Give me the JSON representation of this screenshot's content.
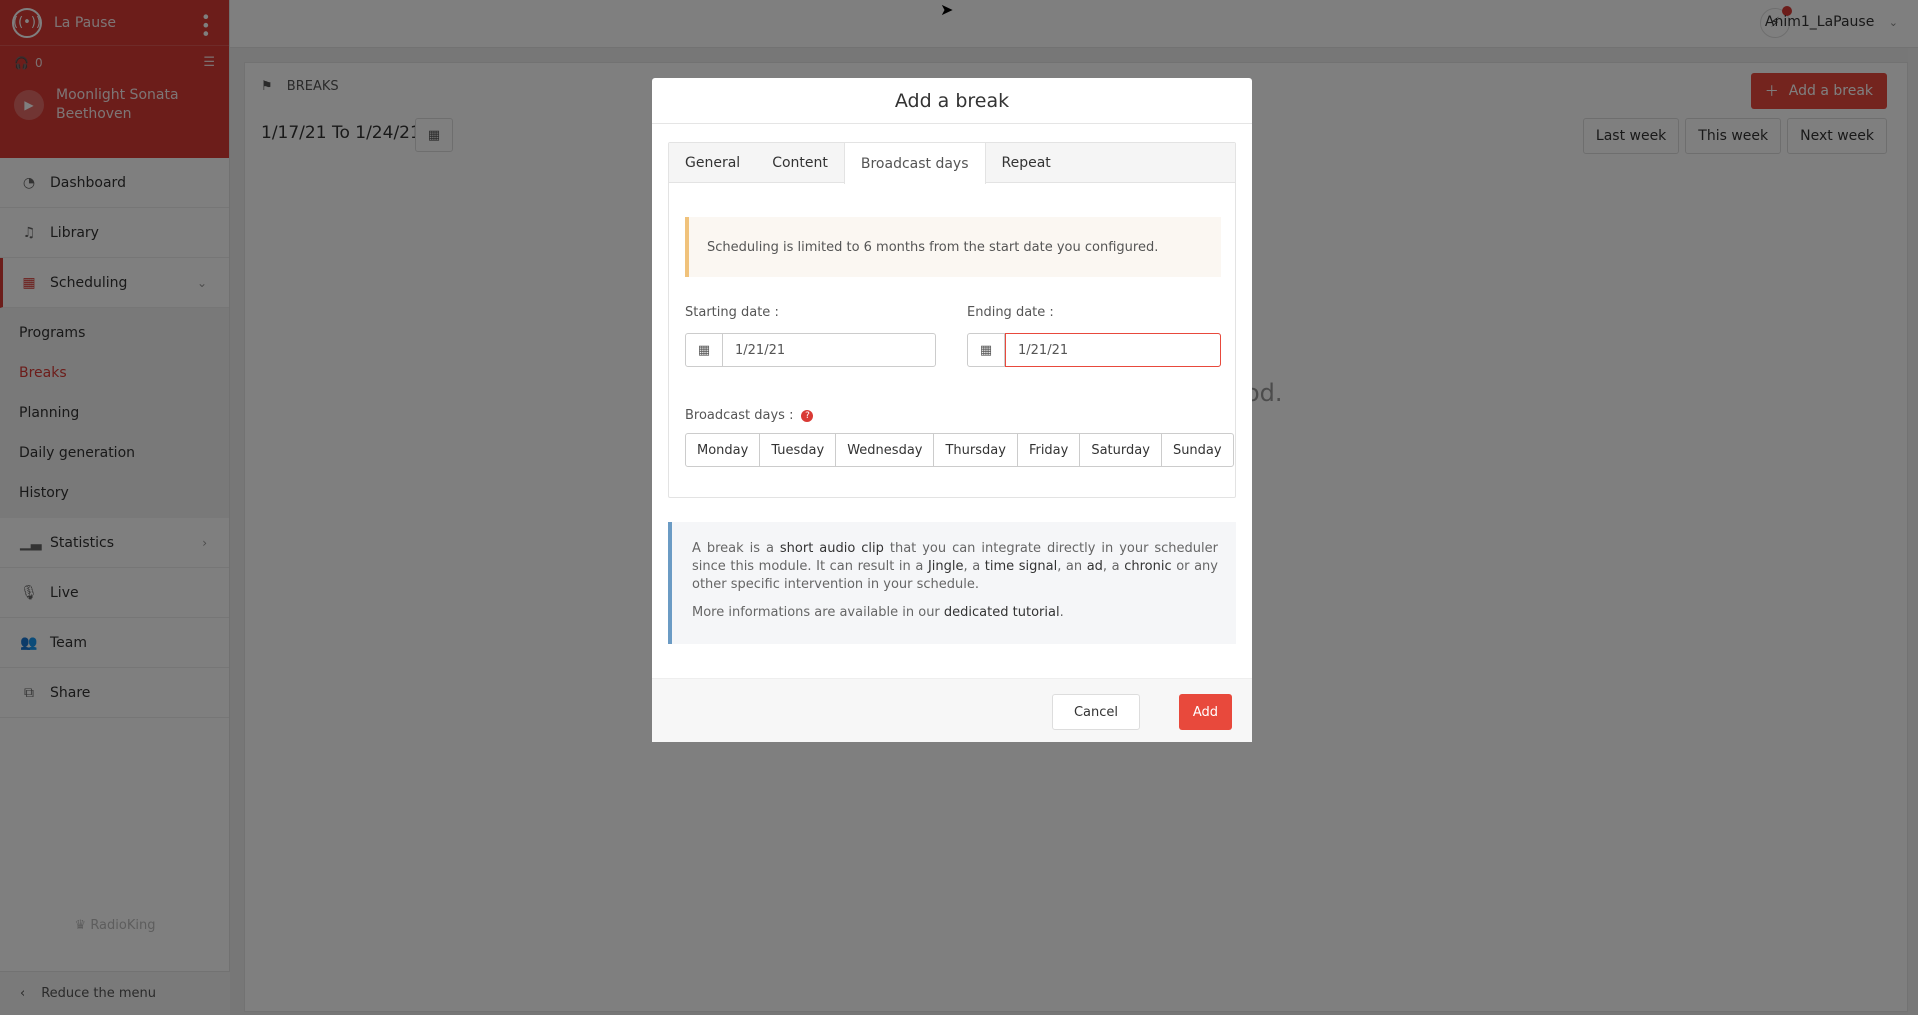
{
  "sidebar": {
    "brand_name": "La Pause",
    "listeners": "0",
    "now_playing": {
      "title": "Moonlight Sonata",
      "artist": "Beethoven"
    },
    "items": [
      {
        "label": "Dashboard",
        "icon": "dashboard-icon"
      },
      {
        "label": "Library",
        "icon": "music-icon"
      },
      {
        "label": "Scheduling",
        "icon": "calendar-icon"
      }
    ],
    "subitems": [
      {
        "label": "Programs"
      },
      {
        "label": "Breaks"
      },
      {
        "label": "Planning"
      },
      {
        "label": "Daily generation"
      },
      {
        "label": "History"
      }
    ],
    "items_after": [
      {
        "label": "Statistics",
        "icon": "chart-icon"
      },
      {
        "label": "Live",
        "icon": "microphone-icon"
      },
      {
        "label": "Team",
        "icon": "users-icon"
      },
      {
        "label": "Share",
        "icon": "share-icon"
      }
    ],
    "footer_logo": "RadioKing",
    "reduce_label": "Reduce the menu"
  },
  "topbar": {
    "username": "Anim1_LaPause"
  },
  "content": {
    "breadcrumb": "BREAKS",
    "date_from": "1/17/21",
    "date_to_word": "To",
    "date_to": "1/24/21",
    "add_button": "Add a break",
    "week_buttons": [
      "Last week",
      "This week",
      "Next week"
    ],
    "background_text": "od."
  },
  "modal": {
    "title": "Add a break",
    "tabs": [
      "General",
      "Content",
      "Broadcast days",
      "Repeat"
    ],
    "active_tab": "Broadcast days",
    "alert": "Scheduling is limited to 6 months from the start date you configured.",
    "start_label": "Starting date :",
    "start_value": "1/21/21",
    "end_label": "Ending date :",
    "end_value": "1/21/21",
    "days_label": "Broadcast days :",
    "days": [
      "Monday",
      "Tuesday",
      "Wednesday",
      "Thursday",
      "Friday",
      "Saturday",
      "Sunday"
    ],
    "info": {
      "p1_a": "A break is a ",
      "p1_b": "short audio clip",
      "p1_c": " that you can integrate directly in your scheduler since this module. It can result in a ",
      "p1_d": "Jingle",
      "p1_e": ", a ",
      "p1_f": "time signal",
      "p1_g": ", an ",
      "p1_h": "ad",
      "p1_i": ", a ",
      "p1_j": "chronic",
      "p1_k": " or any other specific intervention in your schedule.",
      "p2_a": "More informations are available in our ",
      "p2_link": "dedicated tutorial",
      "p2_b": "."
    },
    "cancel": "Cancel",
    "add": "Add"
  },
  "colors": {
    "accent": "#e8493c",
    "brand": "#d93a35",
    "alert_border": "#f0c27b",
    "info_border": "#6b9bc4"
  }
}
